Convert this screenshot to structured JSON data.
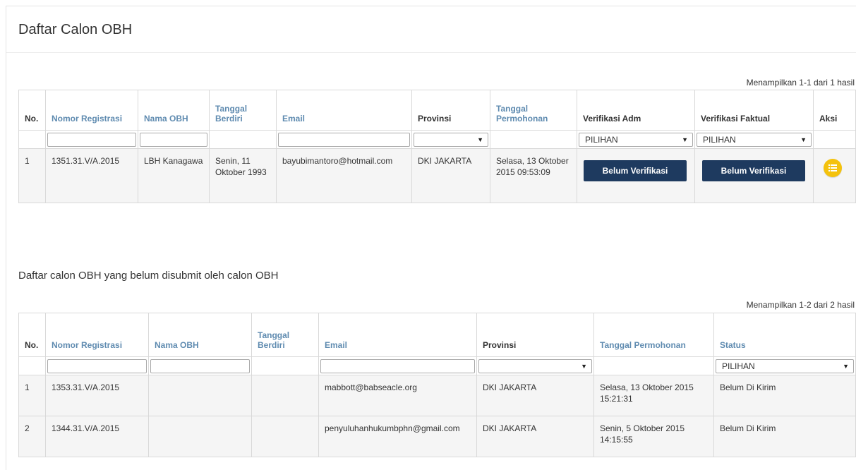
{
  "page_title": "Daftar Calon OBH",
  "table1": {
    "result_count": "Menampilkan 1-1 dari 1 hasil",
    "headers": {
      "no": "No.",
      "nomor_registrasi": "Nomor Registrasi",
      "nama_obh": "Nama OBH",
      "tanggal_berdiri": "Tanggal Berdiri",
      "email": "Email",
      "provinsi": "Provinsi",
      "tanggal_permohonan": "Tanggal Permohonan",
      "verifikasi_adm": "Verifikasi Adm",
      "verifikasi_faktual": "Verifikasi Faktual",
      "aksi": "Aksi"
    },
    "filters": {
      "verifikasi_adm": "PILIHAN",
      "verifikasi_faktual": "PILIHAN"
    },
    "rows": [
      {
        "no": "1",
        "nomor_registrasi": "1351.31.V/A.2015",
        "nama_obh": "LBH Kanagawa",
        "tanggal_berdiri": "Senin, 11 Oktober 1993",
        "email": "bayubimantoro@hotmail.com",
        "provinsi": "DKI JAKARTA",
        "tanggal_permohonan": "Selasa, 13 Oktober 2015 09:53:09",
        "verifikasi_adm": "Belum Verifikasi",
        "verifikasi_faktual": "Belum Verifikasi",
        "aksi_icon": "list-icon"
      }
    ]
  },
  "section2_title": "Daftar calon OBH yang belum disubmit oleh calon OBH",
  "table2": {
    "result_count": "Menampilkan 1-2 dari 2 hasil",
    "headers": {
      "no": "No.",
      "nomor_registrasi": "Nomor Registrasi",
      "nama_obh": "Nama OBH",
      "tanggal_berdiri": "Tanggal Berdiri",
      "email": "Email",
      "provinsi": "Provinsi",
      "tanggal_permohonan": "Tanggal Permohonan",
      "status": "Status"
    },
    "filters": {
      "status": "PILIHAN"
    },
    "rows": [
      {
        "no": "1",
        "nomor_registrasi": "1353.31.V/A.2015",
        "nama_obh": "",
        "tanggal_berdiri": "",
        "email": "mabbott@babseacle.org",
        "provinsi": "DKI JAKARTA",
        "tanggal_permohonan": "Selasa, 13 Oktober 2015 15:21:31",
        "status": "Belum Di Kirim"
      },
      {
        "no": "2",
        "nomor_registrasi": "1344.31.V/A.2015",
        "nama_obh": "",
        "tanggal_berdiri": "",
        "email": "penyuluhanhukumbphn@gmail.com",
        "provinsi": "DKI JAKARTA",
        "tanggal_permohonan": "Senin, 5 Oktober 2015 14:15:55",
        "status": "Belum Di Kirim"
      }
    ]
  },
  "colors": {
    "sortable_header": "#5f8bb0",
    "verify_button": "#1e3a5f",
    "action_icon": "#f4c20d"
  }
}
